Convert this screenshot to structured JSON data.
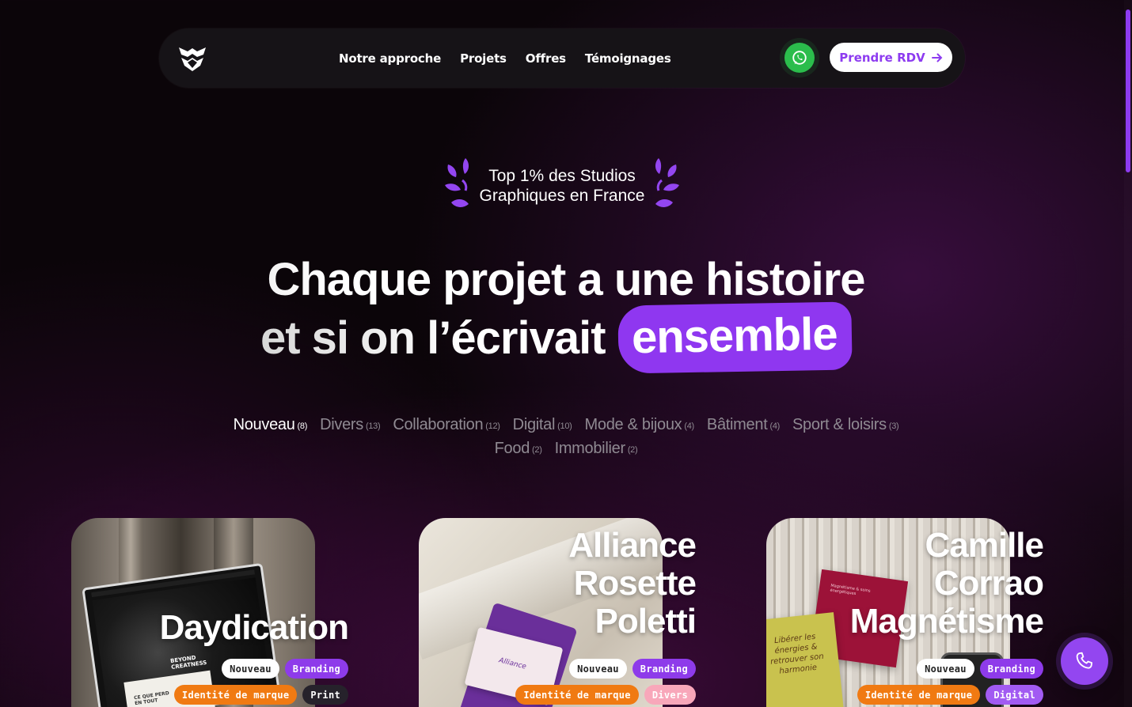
{
  "nav": {
    "links": [
      "Notre approche",
      "Projets",
      "Offres",
      "Témoignages"
    ],
    "cta_label": "Prendre RDV"
  },
  "badge": {
    "line1": "Top 1% des Studios",
    "line2": "Graphiques en France"
  },
  "hero": {
    "line1": "Chaque projet a une histoire",
    "line2": "et si on l’écrivait",
    "highlight": "ensemble"
  },
  "filters": {
    "row1": [
      {
        "label": "Nouveau",
        "count": "(8)",
        "active": true
      },
      {
        "label": "Divers",
        "count": "(13)"
      },
      {
        "label": "Collaboration",
        "count": "(12)"
      },
      {
        "label": "Digital",
        "count": "(10)"
      },
      {
        "label": "Mode & bijoux",
        "count": "(4)"
      },
      {
        "label": "Bâtiment",
        "count": "(4)"
      },
      {
        "label": "Sport & loisirs",
        "count": "(3)"
      }
    ],
    "row2": [
      {
        "label": "Food",
        "count": "(2)"
      },
      {
        "label": "Immobilier",
        "count": "(2)"
      }
    ]
  },
  "cards": [
    {
      "title": "Daydication",
      "tags_row1": [
        "Nouveau",
        "Branding"
      ],
      "tags_row2": [
        "Identité de marque",
        "Print"
      ]
    },
    {
      "title": "Alliance Rosette Poletti",
      "tags_row1": [
        "Nouveau",
        "Branding"
      ],
      "tags_row2": [
        "Identité de marque",
        "Divers"
      ]
    },
    {
      "title": "Camille Corrao Magnétisme",
      "tags_row1": [
        "Nouveau",
        "Branding"
      ],
      "tags_row2": [
        "Identité de marque",
        "Digital"
      ]
    }
  ],
  "mockup_text": {
    "daydication_screen": "BEYOND CREATNESS",
    "daydication_print": "CE QUE PERD EN TOUT",
    "alliance_card": "Alliance",
    "camille_card": "Libérer les énergies & retrouver son harmonie",
    "camille_small": "Magnétisme & soins énergétiques"
  },
  "colors": {
    "accent": "#8e3bea",
    "whatsapp": "#2bbd4c",
    "tag_orange": "#f07a12",
    "tag_pink": "#f8a7ba"
  },
  "icons": [
    "logo-icon",
    "whatsapp-icon",
    "arrow-right-icon",
    "laurel-icon",
    "phone-icon"
  ]
}
